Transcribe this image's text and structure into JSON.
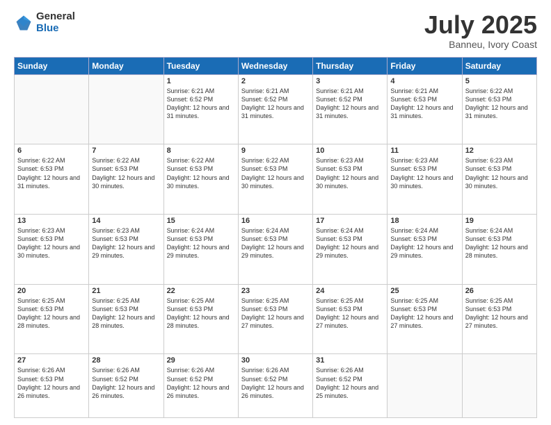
{
  "logo": {
    "general": "General",
    "blue": "Blue"
  },
  "header": {
    "month": "July 2025",
    "location": "Banneu, Ivory Coast"
  },
  "days_of_week": [
    "Sunday",
    "Monday",
    "Tuesday",
    "Wednesday",
    "Thursday",
    "Friday",
    "Saturday"
  ],
  "weeks": [
    [
      null,
      null,
      {
        "day": 1,
        "sunrise": "Sunrise: 6:21 AM",
        "sunset": "Sunset: 6:52 PM",
        "daylight": "Daylight: 12 hours and 31 minutes."
      },
      {
        "day": 2,
        "sunrise": "Sunrise: 6:21 AM",
        "sunset": "Sunset: 6:52 PM",
        "daylight": "Daylight: 12 hours and 31 minutes."
      },
      {
        "day": 3,
        "sunrise": "Sunrise: 6:21 AM",
        "sunset": "Sunset: 6:52 PM",
        "daylight": "Daylight: 12 hours and 31 minutes."
      },
      {
        "day": 4,
        "sunrise": "Sunrise: 6:21 AM",
        "sunset": "Sunset: 6:53 PM",
        "daylight": "Daylight: 12 hours and 31 minutes."
      },
      {
        "day": 5,
        "sunrise": "Sunrise: 6:22 AM",
        "sunset": "Sunset: 6:53 PM",
        "daylight": "Daylight: 12 hours and 31 minutes."
      }
    ],
    [
      {
        "day": 6,
        "sunrise": "Sunrise: 6:22 AM",
        "sunset": "Sunset: 6:53 PM",
        "daylight": "Daylight: 12 hours and 31 minutes."
      },
      {
        "day": 7,
        "sunrise": "Sunrise: 6:22 AM",
        "sunset": "Sunset: 6:53 PM",
        "daylight": "Daylight: 12 hours and 30 minutes."
      },
      {
        "day": 8,
        "sunrise": "Sunrise: 6:22 AM",
        "sunset": "Sunset: 6:53 PM",
        "daylight": "Daylight: 12 hours and 30 minutes."
      },
      {
        "day": 9,
        "sunrise": "Sunrise: 6:22 AM",
        "sunset": "Sunset: 6:53 PM",
        "daylight": "Daylight: 12 hours and 30 minutes."
      },
      {
        "day": 10,
        "sunrise": "Sunrise: 6:23 AM",
        "sunset": "Sunset: 6:53 PM",
        "daylight": "Daylight: 12 hours and 30 minutes."
      },
      {
        "day": 11,
        "sunrise": "Sunrise: 6:23 AM",
        "sunset": "Sunset: 6:53 PM",
        "daylight": "Daylight: 12 hours and 30 minutes."
      },
      {
        "day": 12,
        "sunrise": "Sunrise: 6:23 AM",
        "sunset": "Sunset: 6:53 PM",
        "daylight": "Daylight: 12 hours and 30 minutes."
      }
    ],
    [
      {
        "day": 13,
        "sunrise": "Sunrise: 6:23 AM",
        "sunset": "Sunset: 6:53 PM",
        "daylight": "Daylight: 12 hours and 30 minutes."
      },
      {
        "day": 14,
        "sunrise": "Sunrise: 6:23 AM",
        "sunset": "Sunset: 6:53 PM",
        "daylight": "Daylight: 12 hours and 29 minutes."
      },
      {
        "day": 15,
        "sunrise": "Sunrise: 6:24 AM",
        "sunset": "Sunset: 6:53 PM",
        "daylight": "Daylight: 12 hours and 29 minutes."
      },
      {
        "day": 16,
        "sunrise": "Sunrise: 6:24 AM",
        "sunset": "Sunset: 6:53 PM",
        "daylight": "Daylight: 12 hours and 29 minutes."
      },
      {
        "day": 17,
        "sunrise": "Sunrise: 6:24 AM",
        "sunset": "Sunset: 6:53 PM",
        "daylight": "Daylight: 12 hours and 29 minutes."
      },
      {
        "day": 18,
        "sunrise": "Sunrise: 6:24 AM",
        "sunset": "Sunset: 6:53 PM",
        "daylight": "Daylight: 12 hours and 29 minutes."
      },
      {
        "day": 19,
        "sunrise": "Sunrise: 6:24 AM",
        "sunset": "Sunset: 6:53 PM",
        "daylight": "Daylight: 12 hours and 28 minutes."
      }
    ],
    [
      {
        "day": 20,
        "sunrise": "Sunrise: 6:25 AM",
        "sunset": "Sunset: 6:53 PM",
        "daylight": "Daylight: 12 hours and 28 minutes."
      },
      {
        "day": 21,
        "sunrise": "Sunrise: 6:25 AM",
        "sunset": "Sunset: 6:53 PM",
        "daylight": "Daylight: 12 hours and 28 minutes."
      },
      {
        "day": 22,
        "sunrise": "Sunrise: 6:25 AM",
        "sunset": "Sunset: 6:53 PM",
        "daylight": "Daylight: 12 hours and 28 minutes."
      },
      {
        "day": 23,
        "sunrise": "Sunrise: 6:25 AM",
        "sunset": "Sunset: 6:53 PM",
        "daylight": "Daylight: 12 hours and 27 minutes."
      },
      {
        "day": 24,
        "sunrise": "Sunrise: 6:25 AM",
        "sunset": "Sunset: 6:53 PM",
        "daylight": "Daylight: 12 hours and 27 minutes."
      },
      {
        "day": 25,
        "sunrise": "Sunrise: 6:25 AM",
        "sunset": "Sunset: 6:53 PM",
        "daylight": "Daylight: 12 hours and 27 minutes."
      },
      {
        "day": 26,
        "sunrise": "Sunrise: 6:25 AM",
        "sunset": "Sunset: 6:53 PM",
        "daylight": "Daylight: 12 hours and 27 minutes."
      }
    ],
    [
      {
        "day": 27,
        "sunrise": "Sunrise: 6:26 AM",
        "sunset": "Sunset: 6:53 PM",
        "daylight": "Daylight: 12 hours and 26 minutes."
      },
      {
        "day": 28,
        "sunrise": "Sunrise: 6:26 AM",
        "sunset": "Sunset: 6:52 PM",
        "daylight": "Daylight: 12 hours and 26 minutes."
      },
      {
        "day": 29,
        "sunrise": "Sunrise: 6:26 AM",
        "sunset": "Sunset: 6:52 PM",
        "daylight": "Daylight: 12 hours and 26 minutes."
      },
      {
        "day": 30,
        "sunrise": "Sunrise: 6:26 AM",
        "sunset": "Sunset: 6:52 PM",
        "daylight": "Daylight: 12 hours and 26 minutes."
      },
      {
        "day": 31,
        "sunrise": "Sunrise: 6:26 AM",
        "sunset": "Sunset: 6:52 PM",
        "daylight": "Daylight: 12 hours and 25 minutes."
      },
      null,
      null
    ]
  ]
}
